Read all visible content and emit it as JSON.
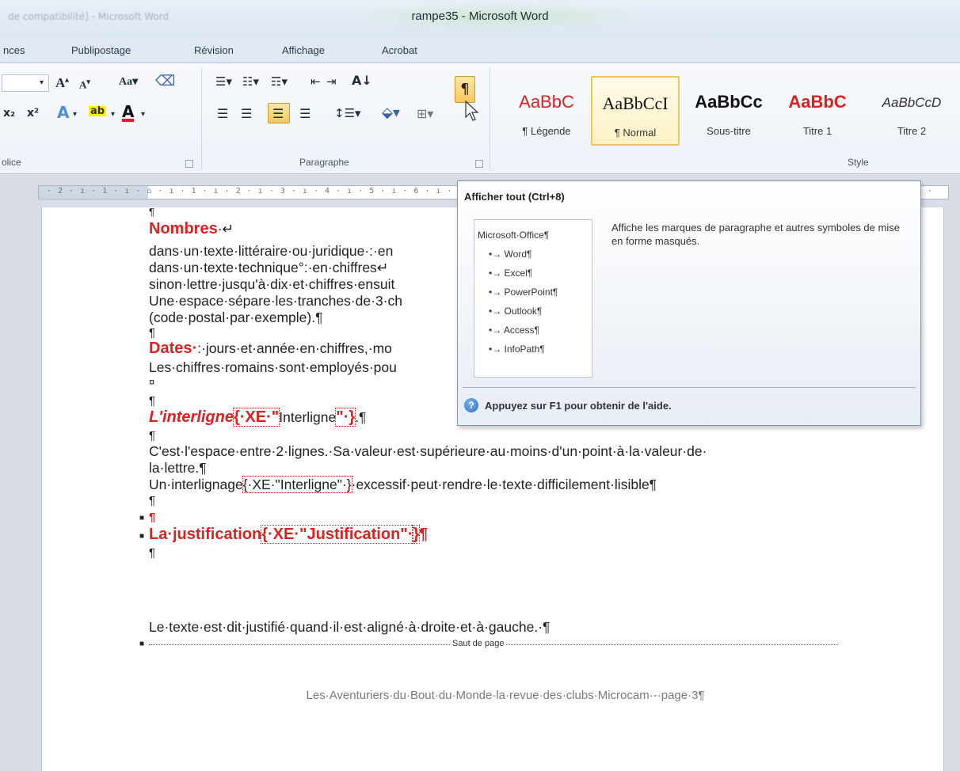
{
  "window": {
    "title": "rampe35 - Microsoft Word",
    "faded_left": "de compatibilité] - Microsoft Word"
  },
  "tabs": [
    "nces",
    "Publipostage",
    "Révision",
    "Affichage",
    "Acrobat"
  ],
  "ribbon": {
    "groups": {
      "police": "olice",
      "paragraphe": "Paragraphe",
      "style": "Style"
    },
    "show_all_glyph": "¶",
    "styles": [
      {
        "sample": "AaBbC",
        "name": "¶ Légende",
        "color": "#e02020"
      },
      {
        "sample": "AaBbCcI",
        "name": "¶ Normal",
        "color": "#111111",
        "selected": true
      },
      {
        "sample": "AaBbCc",
        "name": "Sous-titre",
        "color": "#111111"
      },
      {
        "sample": "AaBbC",
        "name": "Titre 1",
        "color": "#e02020"
      },
      {
        "sample": "AaBbCcD",
        "name": "Titre 2",
        "color": "#333333"
      }
    ]
  },
  "ruler": {
    "ticks": "· 2 · ı · 1 · ı · ⌂ · ı · 1 · ı · 2 · ı · 3 · ı · 4 · ı · 5 · ı · 6 · ı · 7",
    "right": "8 ·"
  },
  "document": {
    "l1": "¶",
    "l2a": "Nombres",
    "l2b": "·↵",
    "l3": "dans·un·texte·littéraire·ou·juridique·:·en",
    "l4": "dans·un·texte·technique°:·en·chiffres↵",
    "l5": "sinon·lettre·jusqu'à·dix·et·chiffres·ensuit",
    "l6": "Une·espace·sépare·les·tranches·de·3·ch",
    "l7": "(code·postal·par·exemple).¶",
    "l8": "¶",
    "l9a": "Dates·",
    "l9b": ":·jours·et·année·en·chiffres,·mo",
    "l10": "Les·chiffres·romains·sont·employés·pou",
    "l11": "¤",
    "l12": "¶",
    "l13a": "L'interligne",
    "l13b": "{·XE·\"",
    "l13c": "Interligne",
    "l13d": "\"·}",
    "l13e": ".¶",
    "l14": "¶",
    "l15": "C'est·l'espace·entre·2·lignes.·Sa·valeur·est·supérieure·au·moins·d'un·point·à·la·valeur·de·",
    "l16": "la·lettre.¶",
    "l17a": "Un·interlignage",
    "l17b": "{·XE·\"Interligne\"·}",
    "l17c": "·excessif·peut·rendre·le·texte·difficilement·lisible¶",
    "l18": "¶",
    "l19": "¶",
    "l20a": "La·justification",
    "l20b": "{·XE·\"Justification\"·",
    "l20c": "}",
    "l20d": "¶",
    "l21": "¶",
    "l22": "Le·texte·est·dit·justifié·quand·il·est·aligné·à·droite·et·à·gauche.·¶",
    "page_break": "Saut de page",
    "footer": "Les·Aventuriers·du·Bout·du·Monde·la·revue·des·clubs·Microcam·-·page·3¶"
  },
  "tooltip": {
    "title": "Afficher tout (Ctrl+8)",
    "preview": [
      "Microsoft·Office¶",
      "•→ Word¶",
      "•→ Excel¶",
      "•→ PowerPoint¶",
      "•→ Outlook¶",
      "•→ Access¶",
      "•→ InfoPath¶"
    ],
    "description": "Affiche les marques de paragraphe et autres symboles de mise en forme masqués.",
    "help": "Appuyez sur F1 pour obtenir de l'aide."
  }
}
